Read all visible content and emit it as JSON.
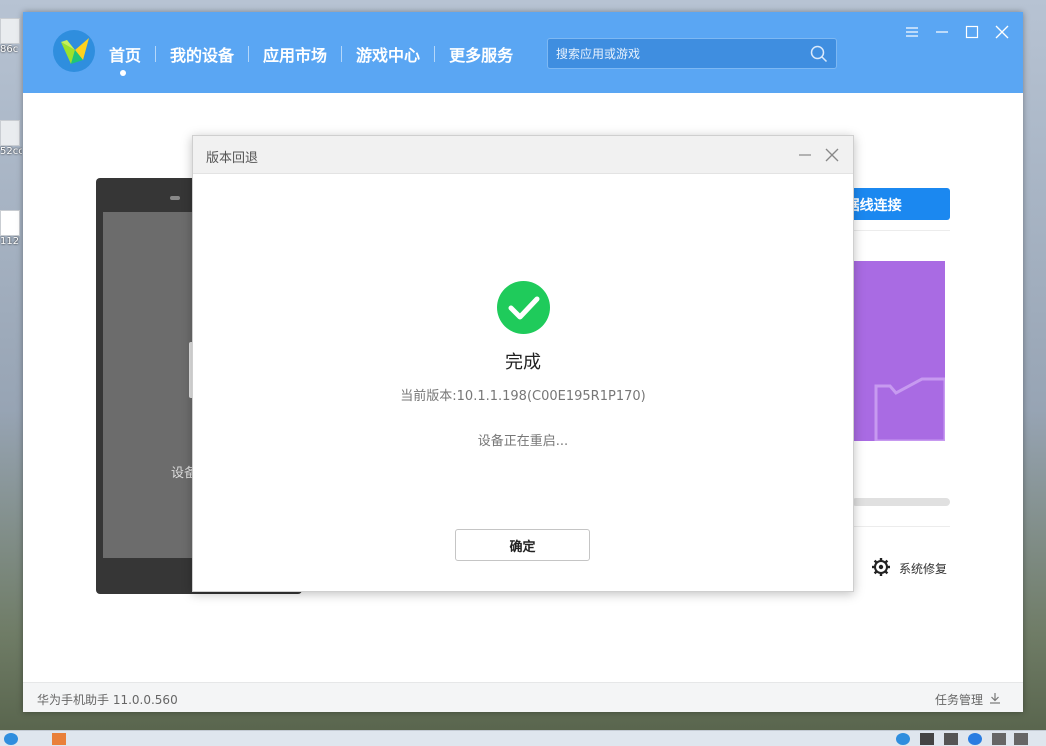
{
  "desktop": {
    "icon_labels": [
      "86c",
      "52cc",
      "112"
    ]
  },
  "nav": {
    "items": [
      {
        "label": "首页",
        "active": true
      },
      {
        "label": "我的设备"
      },
      {
        "label": "应用市场"
      },
      {
        "label": "游戏中心"
      },
      {
        "label": "更多服务"
      }
    ]
  },
  "search": {
    "placeholder": "搜索应用或游戏"
  },
  "background": {
    "phone_text": "设备",
    "usb_button_label": "B数据线连接",
    "repair_label": "系统修复",
    "progress_percent": 0
  },
  "dialog": {
    "title": "版本回退",
    "status": "完成",
    "version_text": "当前版本:10.1.1.198(C00E195R1P170)",
    "message": "设备正在重启...",
    "confirm_label": "确定"
  },
  "status_bar": {
    "app_version": "华为手机助手 11.0.0.560",
    "task_manager": "任务管理"
  },
  "colors": {
    "header": "#5aa6f3",
    "success": "#1fcb5b",
    "primary_button": "#1b88f0",
    "promo": "#a96be3"
  }
}
